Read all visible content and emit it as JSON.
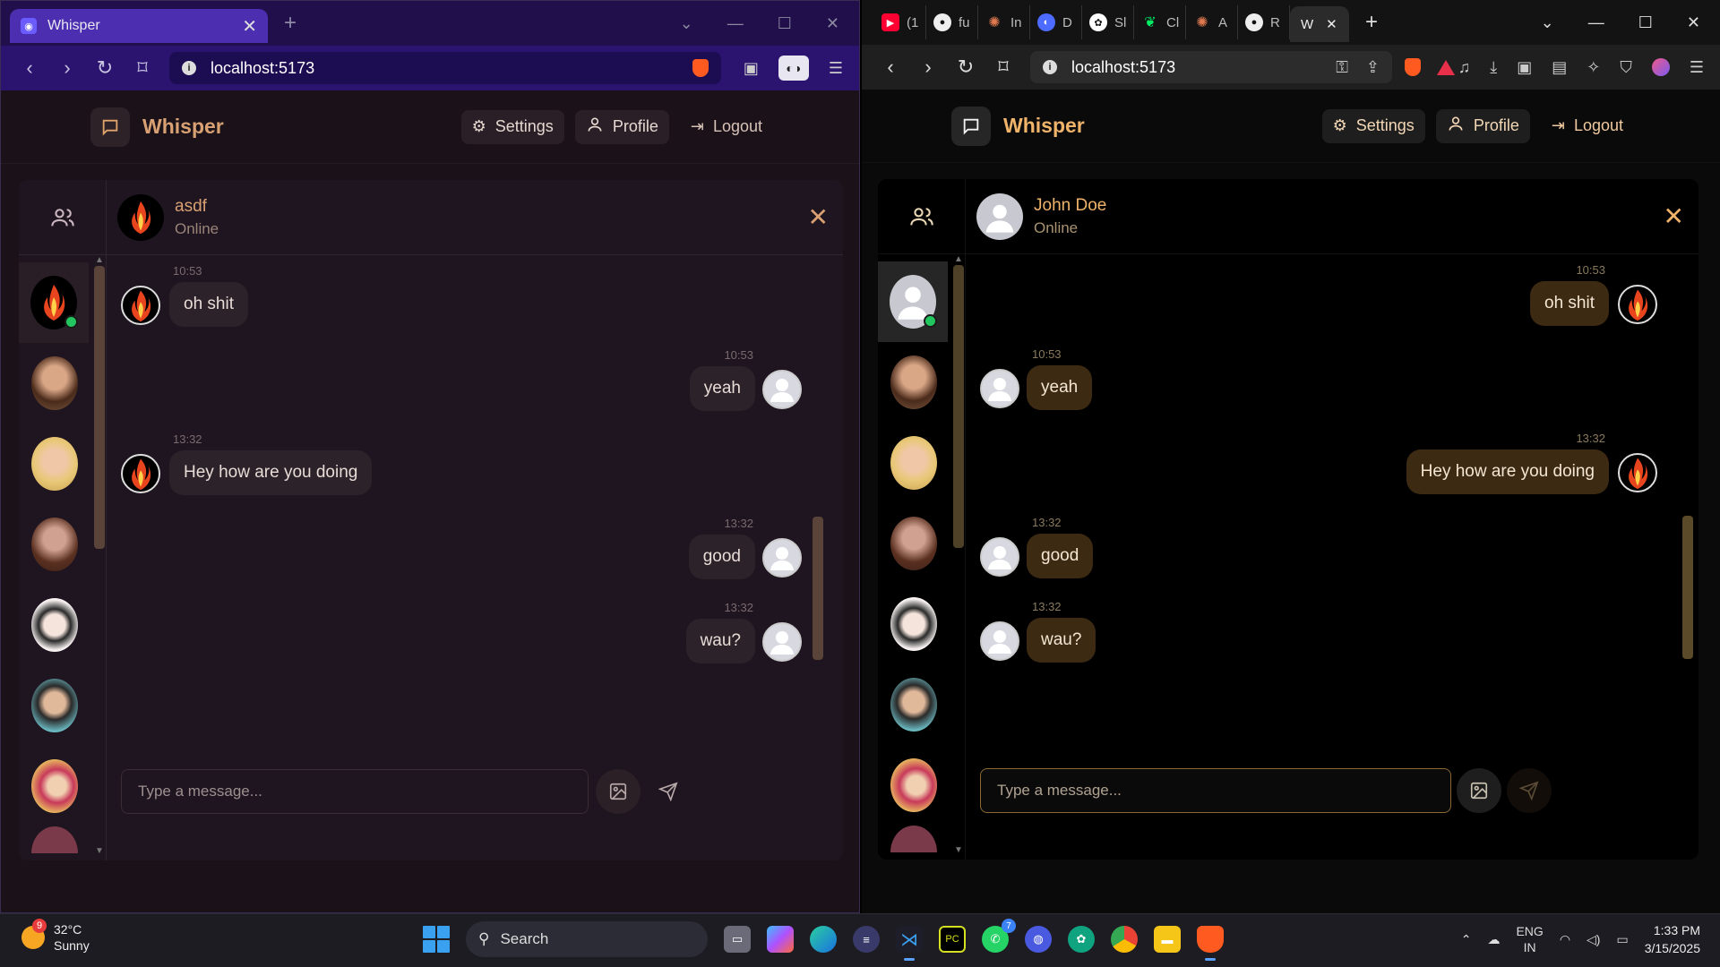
{
  "left_window": {
    "tab_title": "Whisper",
    "url": "localhost:5173",
    "app": {
      "brand": "Whisper",
      "settings_label": "Settings",
      "profile_label": "Profile",
      "logout_label": "Logout",
      "chat_name": "asdf",
      "chat_status": "Online",
      "input_placeholder": "Type a message...",
      "messages": [
        {
          "time": "10:53",
          "text": "oh shit",
          "side": "left"
        },
        {
          "time": "10:53",
          "text": "yeah",
          "side": "right"
        },
        {
          "time": "13:32",
          "text": "Hey how are you doing",
          "side": "left"
        },
        {
          "time": "13:32",
          "text": "good",
          "side": "right"
        },
        {
          "time": "13:32",
          "text": "wau?",
          "side": "right"
        }
      ]
    }
  },
  "right_window": {
    "tabs": [
      "(1",
      "fu",
      "In",
      "D",
      "Sl",
      "Cl",
      "A",
      "R",
      "W"
    ],
    "url": "localhost:5173",
    "app": {
      "brand": "Whisper",
      "settings_label": "Settings",
      "profile_label": "Profile",
      "logout_label": "Logout",
      "chat_name": "John Doe",
      "chat_status": "Online",
      "input_placeholder": "Type a message...",
      "messages": [
        {
          "time": "10:53",
          "text": "oh shit",
          "side": "right"
        },
        {
          "time": "10:53",
          "text": "yeah",
          "side": "left"
        },
        {
          "time": "13:32",
          "text": "Hey how are you doing",
          "side": "right"
        },
        {
          "time": "13:32",
          "text": "good",
          "side": "left"
        },
        {
          "time": "13:32",
          "text": "wau?",
          "side": "left"
        }
      ]
    }
  },
  "taskbar": {
    "weather_temp": "32°C",
    "weather_desc": "Sunny",
    "weather_badge": "9",
    "search_label": "Search",
    "whatsapp_badge": "7",
    "lang_top": "ENG",
    "lang_bottom": "IN",
    "time": "1:33 PM",
    "date": "3/15/2025"
  },
  "colors": {
    "left_accent": "#d9a173",
    "right_accent": "#f0b36a",
    "online": "#22c55e",
    "left_tabbar": "#4b2fb0"
  }
}
